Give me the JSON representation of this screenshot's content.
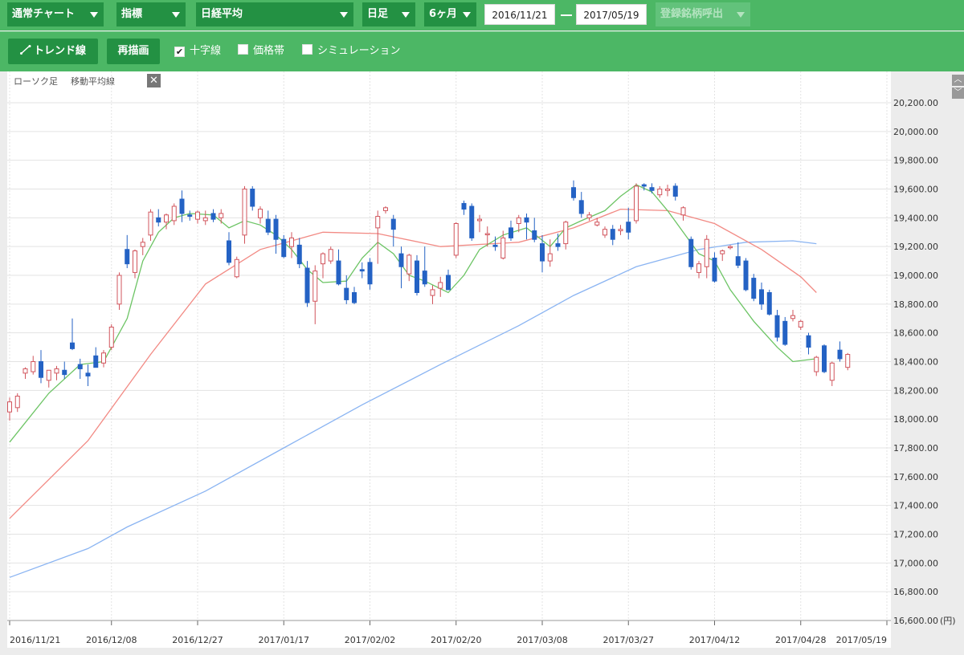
{
  "toolbar": {
    "chart_type": "通常チャート",
    "indicator": "指標",
    "symbol": "日経平均",
    "interval": "日足",
    "period": "6ヶ月",
    "date_from": "2016/11/21",
    "date_to": "2017/05/19",
    "saved_symbols": "登録銘柄呼出"
  },
  "toolbar2": {
    "trend_line": "トレンド線",
    "redraw": "再描画",
    "crosshair": "十字線",
    "price_band": "価格帯",
    "simulation": "シミュレーション"
  },
  "legend": {
    "candle": "ローソク足",
    "moving_average": "移動平均線"
  },
  "colors": {
    "up": "#d1545c",
    "down": "#2462c4",
    "ma_short": "#6cc464",
    "ma_mid": "#f28a84",
    "ma_long": "#8ab4f2",
    "box": "#b574c4",
    "grid": "#e3e3e3"
  },
  "chart_data": {
    "type": "candlestick",
    "ylim": [
      16600,
      20200
    ],
    "y_ticks": [
      "20,200.00",
      "20,000.00",
      "19,800.00",
      "19,600.00",
      "19,400.00",
      "19,200.00",
      "19,000.00",
      "18,800.00",
      "18,600.00",
      "18,400.00",
      "18,200.00",
      "18,000.00",
      "17,800.00",
      "17,600.00",
      "17,400.00",
      "17,200.00",
      "17,000.00",
      "16,800.00",
      "16,600.00"
    ],
    "y_unit": "(円)",
    "x_labels": [
      "2016/11/21",
      "2016/12/08",
      "2016/12/27",
      "2017/01/17",
      "2017/02/02",
      "2017/02/20",
      "2017/03/08",
      "2017/03/27",
      "2017/04/12",
      "2017/04/28",
      "2017/05/19"
    ],
    "x_label_index": [
      0,
      13,
      24,
      35,
      46,
      57,
      68,
      79,
      90,
      101,
      112
    ],
    "candles": [
      {
        "o": 18050,
        "h": 18150,
        "l": 17990,
        "c": 18120
      },
      {
        "o": 18080,
        "h": 18180,
        "l": 18050,
        "c": 18160
      },
      {
        "o": 18320,
        "h": 18360,
        "l": 18280,
        "c": 18350
      },
      {
        "o": 18330,
        "h": 18440,
        "l": 18310,
        "c": 18400
      },
      {
        "o": 18400,
        "h": 18480,
        "l": 18250,
        "c": 18290
      },
      {
        "o": 18270,
        "h": 18340,
        "l": 18220,
        "c": 18340
      },
      {
        "o": 18320,
        "h": 18370,
        "l": 18270,
        "c": 18350
      },
      {
        "o": 18340,
        "h": 18400,
        "l": 18280,
        "c": 18310
      },
      {
        "o": 18530,
        "h": 18700,
        "l": 18480,
        "c": 18490
      },
      {
        "o": 18380,
        "h": 18420,
        "l": 18280,
        "c": 18350
      },
      {
        "o": 18320,
        "h": 18380,
        "l": 18230,
        "c": 18300
      },
      {
        "o": 18440,
        "h": 18500,
        "l": 18360,
        "c": 18360
      },
      {
        "o": 18390,
        "h": 18480,
        "l": 18360,
        "c": 18460
      },
      {
        "o": 18500,
        "h": 18660,
        "l": 18480,
        "c": 18640
      },
      {
        "o": 18800,
        "h": 19020,
        "l": 18760,
        "c": 19000
      },
      {
        "o": 19180,
        "h": 19280,
        "l": 19050,
        "c": 19080
      },
      {
        "o": 19020,
        "h": 19180,
        "l": 18980,
        "c": 19170
      },
      {
        "o": 19200,
        "h": 19260,
        "l": 19140,
        "c": 19230
      },
      {
        "o": 19280,
        "h": 19460,
        "l": 19240,
        "c": 19440
      },
      {
        "o": 19400,
        "h": 19460,
        "l": 19340,
        "c": 19370
      },
      {
        "o": 19370,
        "h": 19430,
        "l": 19320,
        "c": 19420
      },
      {
        "o": 19380,
        "h": 19500,
        "l": 19350,
        "c": 19480
      },
      {
        "o": 19530,
        "h": 19590,
        "l": 19370,
        "c": 19430
      },
      {
        "o": 19420,
        "h": 19450,
        "l": 19380,
        "c": 19410
      },
      {
        "o": 19390,
        "h": 19450,
        "l": 19360,
        "c": 19440
      },
      {
        "o": 19380,
        "h": 19450,
        "l": 19350,
        "c": 19400
      },
      {
        "o": 19430,
        "h": 19460,
        "l": 19370,
        "c": 19390
      },
      {
        "o": 19400,
        "h": 19460,
        "l": 19360,
        "c": 19430
      },
      {
        "o": 19240,
        "h": 19300,
        "l": 19070,
        "c": 19090
      },
      {
        "o": 18990,
        "h": 19130,
        "l": 18980,
        "c": 19110
      },
      {
        "o": 19280,
        "h": 19620,
        "l": 19220,
        "c": 19600
      },
      {
        "o": 19600,
        "h": 19620,
        "l": 19450,
        "c": 19480
      },
      {
        "o": 19400,
        "h": 19480,
        "l": 19360,
        "c": 19460
      },
      {
        "o": 19390,
        "h": 19450,
        "l": 19280,
        "c": 19300
      },
      {
        "o": 19390,
        "h": 19420,
        "l": 19150,
        "c": 19250
      },
      {
        "o": 19250,
        "h": 19280,
        "l": 19120,
        "c": 19130
      },
      {
        "o": 19200,
        "h": 19300,
        "l": 19120,
        "c": 19260
      },
      {
        "o": 19210,
        "h": 19260,
        "l": 19050,
        "c": 19080
      },
      {
        "o": 19050,
        "h": 19100,
        "l": 18780,
        "c": 18810
      },
      {
        "o": 18820,
        "h": 19070,
        "l": 18660,
        "c": 19030
      },
      {
        "o": 19080,
        "h": 19160,
        "l": 18980,
        "c": 19150
      },
      {
        "o": 19100,
        "h": 19200,
        "l": 19080,
        "c": 19180
      },
      {
        "o": 19100,
        "h": 19180,
        "l": 18930,
        "c": 18940
      },
      {
        "o": 18910,
        "h": 19000,
        "l": 18800,
        "c": 18830
      },
      {
        "o": 18880,
        "h": 18920,
        "l": 18800,
        "c": 18810
      },
      {
        "o": 19040,
        "h": 19090,
        "l": 18980,
        "c": 19030
      },
      {
        "o": 19090,
        "h": 19120,
        "l": 18900,
        "c": 18940
      },
      {
        "o": 19330,
        "h": 19450,
        "l": 19080,
        "c": 19410
      },
      {
        "o": 19450,
        "h": 19480,
        "l": 19430,
        "c": 19470
      },
      {
        "o": 19390,
        "h": 19420,
        "l": 19200,
        "c": 19320
      },
      {
        "o": 19150,
        "h": 19200,
        "l": 18910,
        "c": 19060
      },
      {
        "o": 19010,
        "h": 19150,
        "l": 18960,
        "c": 19140
      },
      {
        "o": 19100,
        "h": 19140,
        "l": 18860,
        "c": 18880
      },
      {
        "o": 19030,
        "h": 19200,
        "l": 18920,
        "c": 18940
      },
      {
        "o": 18860,
        "h": 18930,
        "l": 18800,
        "c": 18900
      },
      {
        "o": 18910,
        "h": 18990,
        "l": 18850,
        "c": 18950
      },
      {
        "o": 19000,
        "h": 19040,
        "l": 18900,
        "c": 18900
      },
      {
        "o": 19140,
        "h": 19370,
        "l": 19120,
        "c": 19360
      },
      {
        "o": 19500,
        "h": 19520,
        "l": 19420,
        "c": 19460
      },
      {
        "o": 19480,
        "h": 19500,
        "l": 19240,
        "c": 19260
      },
      {
        "o": 19380,
        "h": 19420,
        "l": 19300,
        "c": 19390
      },
      {
        "o": 19290,
        "h": 19340,
        "l": 19200,
        "c": 19290
      },
      {
        "o": 19210,
        "h": 19270,
        "l": 19170,
        "c": 19200
      },
      {
        "o": 19120,
        "h": 19310,
        "l": 19110,
        "c": 19260
      },
      {
        "o": 19330,
        "h": 19380,
        "l": 19240,
        "c": 19260
      },
      {
        "o": 19360,
        "h": 19420,
        "l": 19300,
        "c": 19400
      },
      {
        "o": 19400,
        "h": 19430,
        "l": 19250,
        "c": 19370
      },
      {
        "o": 19310,
        "h": 19400,
        "l": 19230,
        "c": 19250
      },
      {
        "o": 19220,
        "h": 19280,
        "l": 19020,
        "c": 19100
      },
      {
        "o": 19100,
        "h": 19250,
        "l": 19060,
        "c": 19150
      },
      {
        "o": 19220,
        "h": 19290,
        "l": 19170,
        "c": 19200
      },
      {
        "o": 19220,
        "h": 19380,
        "l": 19180,
        "c": 19370
      },
      {
        "o": 19610,
        "h": 19660,
        "l": 19520,
        "c": 19540
      },
      {
        "o": 19520,
        "h": 19580,
        "l": 19400,
        "c": 19430
      },
      {
        "o": 19400,
        "h": 19440,
        "l": 19380,
        "c": 19420
      },
      {
        "o": 19350,
        "h": 19400,
        "l": 19340,
        "c": 19370
      },
      {
        "o": 19280,
        "h": 19340,
        "l": 19260,
        "c": 19320
      },
      {
        "o": 19320,
        "h": 19350,
        "l": 19210,
        "c": 19250
      },
      {
        "o": 19310,
        "h": 19350,
        "l": 19280,
        "c": 19320
      },
      {
        "o": 19370,
        "h": 19470,
        "l": 19250,
        "c": 19300
      },
      {
        "o": 19380,
        "h": 19640,
        "l": 19360,
        "c": 19620
      },
      {
        "o": 19630,
        "h": 19640,
        "l": 19590,
        "c": 19620
      },
      {
        "o": 19610,
        "h": 19640,
        "l": 19570,
        "c": 19590
      },
      {
        "o": 19560,
        "h": 19620,
        "l": 19540,
        "c": 19600
      },
      {
        "o": 19590,
        "h": 19630,
        "l": 19550,
        "c": 19600
      },
      {
        "o": 19620,
        "h": 19640,
        "l": 19520,
        "c": 19550
      },
      {
        "o": 19420,
        "h": 19480,
        "l": 19380,
        "c": 19470
      },
      {
        "o": 19250,
        "h": 19270,
        "l": 19040,
        "c": 19060
      },
      {
        "o": 19020,
        "h": 19100,
        "l": 18980,
        "c": 19080
      },
      {
        "o": 19060,
        "h": 19280,
        "l": 18980,
        "c": 19250
      },
      {
        "o": 19120,
        "h": 19160,
        "l": 18950,
        "c": 18960
      },
      {
        "o": 19150,
        "h": 19180,
        "l": 19100,
        "c": 19170
      },
      {
        "o": 19200,
        "h": 19210,
        "l": 19180,
        "c": 19200
      },
      {
        "o": 19130,
        "h": 19230,
        "l": 19050,
        "c": 19070
      },
      {
        "o": 19100,
        "h": 19120,
        "l": 18890,
        "c": 18900
      },
      {
        "o": 18980,
        "h": 19010,
        "l": 18820,
        "c": 18840
      },
      {
        "o": 18900,
        "h": 18950,
        "l": 18760,
        "c": 18800
      },
      {
        "o": 18880,
        "h": 18900,
        "l": 18720,
        "c": 18730
      },
      {
        "o": 18720,
        "h": 18760,
        "l": 18540,
        "c": 18570
      },
      {
        "o": 18680,
        "h": 18710,
        "l": 18510,
        "c": 18520
      },
      {
        "o": 18700,
        "h": 18760,
        "l": 18680,
        "c": 18720
      },
      {
        "o": 18640,
        "h": 18690,
        "l": 18620,
        "c": 18680
      },
      {
        "o": 18580,
        "h": 18600,
        "l": 18450,
        "c": 18500
      },
      {
        "o": 18330,
        "h": 18440,
        "l": 18300,
        "c": 18430
      },
      {
        "o": 18510,
        "h": 18520,
        "l": 18320,
        "c": 18330
      },
      {
        "o": 18270,
        "h": 18400,
        "l": 18230,
        "c": 18390
      },
      {
        "o": 18480,
        "h": 18540,
        "l": 18400,
        "c": 18420
      },
      {
        "o": 18360,
        "h": 18460,
        "l": 18340,
        "c": 18450
      }
    ],
    "ma_short": [
      [
        0,
        17840
      ],
      [
        5,
        18180
      ],
      [
        9,
        18380
      ],
      [
        12,
        18400
      ],
      [
        15,
        18700
      ],
      [
        17,
        19100
      ],
      [
        19,
        19300
      ],
      [
        21,
        19400
      ],
      [
        23,
        19430
      ],
      [
        26,
        19420
      ],
      [
        28,
        19330
      ],
      [
        30,
        19380
      ],
      [
        32,
        19350
      ],
      [
        34,
        19280
      ],
      [
        36,
        19180
      ],
      [
        38,
        19040
      ],
      [
        40,
        18950
      ],
      [
        43,
        18960
      ],
      [
        45,
        19120
      ],
      [
        47,
        19230
      ],
      [
        49,
        19150
      ],
      [
        51,
        19000
      ],
      [
        53,
        18960
      ],
      [
        56,
        18880
      ],
      [
        58,
        19000
      ],
      [
        60,
        19180
      ],
      [
        63,
        19280
      ],
      [
        66,
        19330
      ],
      [
        69,
        19200
      ],
      [
        71,
        19330
      ],
      [
        73,
        19380
      ],
      [
        76,
        19450
      ],
      [
        78,
        19550
      ],
      [
        80,
        19630
      ],
      [
        82,
        19580
      ],
      [
        84,
        19450
      ],
      [
        86,
        19300
      ],
      [
        88,
        19150
      ],
      [
        90,
        19100
      ],
      [
        92,
        18900
      ],
      [
        95,
        18680
      ],
      [
        98,
        18500
      ],
      [
        100,
        18400
      ],
      [
        103,
        18420
      ]
    ],
    "ma_mid": [
      [
        0,
        17310
      ],
      [
        10,
        17850
      ],
      [
        18,
        18450
      ],
      [
        25,
        18940
      ],
      [
        32,
        19180
      ],
      [
        40,
        19300
      ],
      [
        47,
        19290
      ],
      [
        55,
        19200
      ],
      [
        65,
        19230
      ],
      [
        72,
        19330
      ],
      [
        78,
        19460
      ],
      [
        84,
        19450
      ],
      [
        90,
        19360
      ],
      [
        96,
        19180
      ],
      [
        101,
        18990
      ],
      [
        103,
        18880
      ]
    ],
    "ma_long": [
      [
        0,
        16900
      ],
      [
        10,
        17100
      ],
      [
        15,
        17250
      ],
      [
        25,
        17500
      ],
      [
        35,
        17800
      ],
      [
        45,
        18100
      ],
      [
        55,
        18380
      ],
      [
        65,
        18650
      ],
      [
        72,
        18860
      ],
      [
        80,
        19060
      ],
      [
        88,
        19180
      ],
      [
        94,
        19230
      ],
      [
        100,
        19240
      ],
      [
        103,
        19220
      ]
    ],
    "boxes": []
  }
}
